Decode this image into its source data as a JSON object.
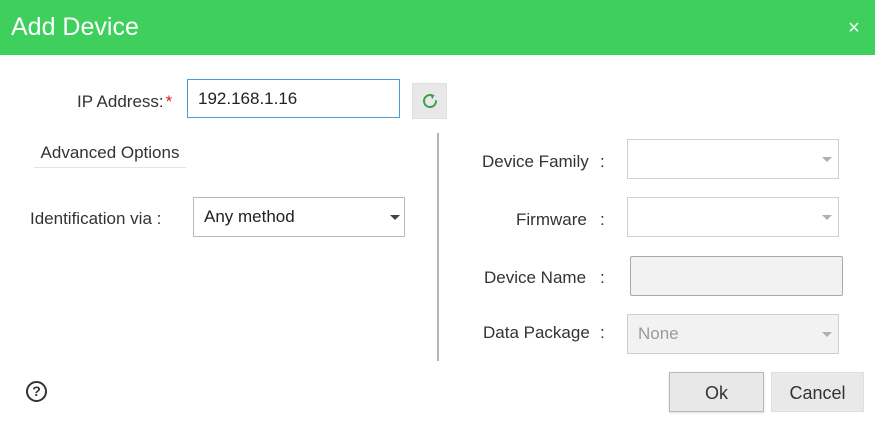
{
  "dialog": {
    "title": "Add Device",
    "close_glyph": "×",
    "close_icon": "close-icon"
  },
  "ip": {
    "label": "IP Address",
    "colon": ":",
    "required_mark": "*",
    "value": "192.168.1.16",
    "refresh_icon": "refresh-icon",
    "accent_color": "#3aa34a"
  },
  "advanced": {
    "tab_label": "Advanced Options",
    "identification_label": "Identification via",
    "colon": ":",
    "identification_value": "Any method"
  },
  "details": {
    "colon": ":",
    "device_family": {
      "label": "Device Family",
      "value": ""
    },
    "firmware": {
      "label": "Firmware",
      "value": ""
    },
    "device_name": {
      "label": "Device Name",
      "value": ""
    },
    "data_package": {
      "label": "Data Package",
      "value": "None"
    }
  },
  "footer": {
    "help_glyph": "?",
    "help_icon": "help-icon",
    "ok_label": "Ok",
    "cancel_label": "Cancel"
  },
  "colors": {
    "header": "#3ecf5c",
    "required": "#d9182d",
    "input_focus_border": "#4a9bd9"
  }
}
